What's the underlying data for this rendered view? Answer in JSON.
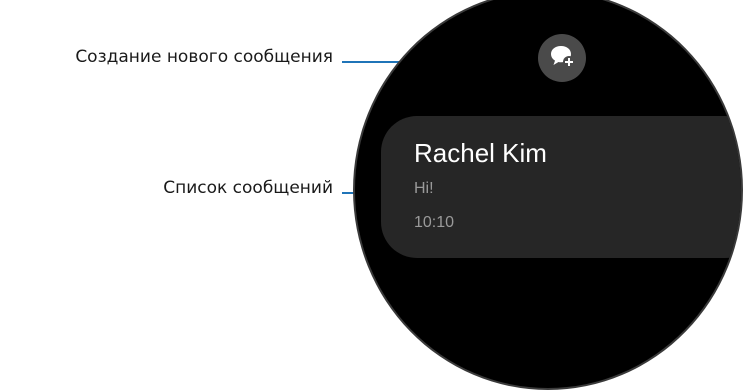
{
  "callouts": {
    "new_message": "Создание нового сообщения",
    "message_list": "Список сообщений"
  },
  "watch": {
    "compose_icon": "new-message-icon",
    "message": {
      "name": "Rachel Kim",
      "preview": "Hi!",
      "time": "10:10"
    }
  },
  "colors": {
    "leader_line": "#1f74b8",
    "screen_bg": "#000000",
    "card_bg": "#262626",
    "button_bg": "#4a4a4a"
  }
}
